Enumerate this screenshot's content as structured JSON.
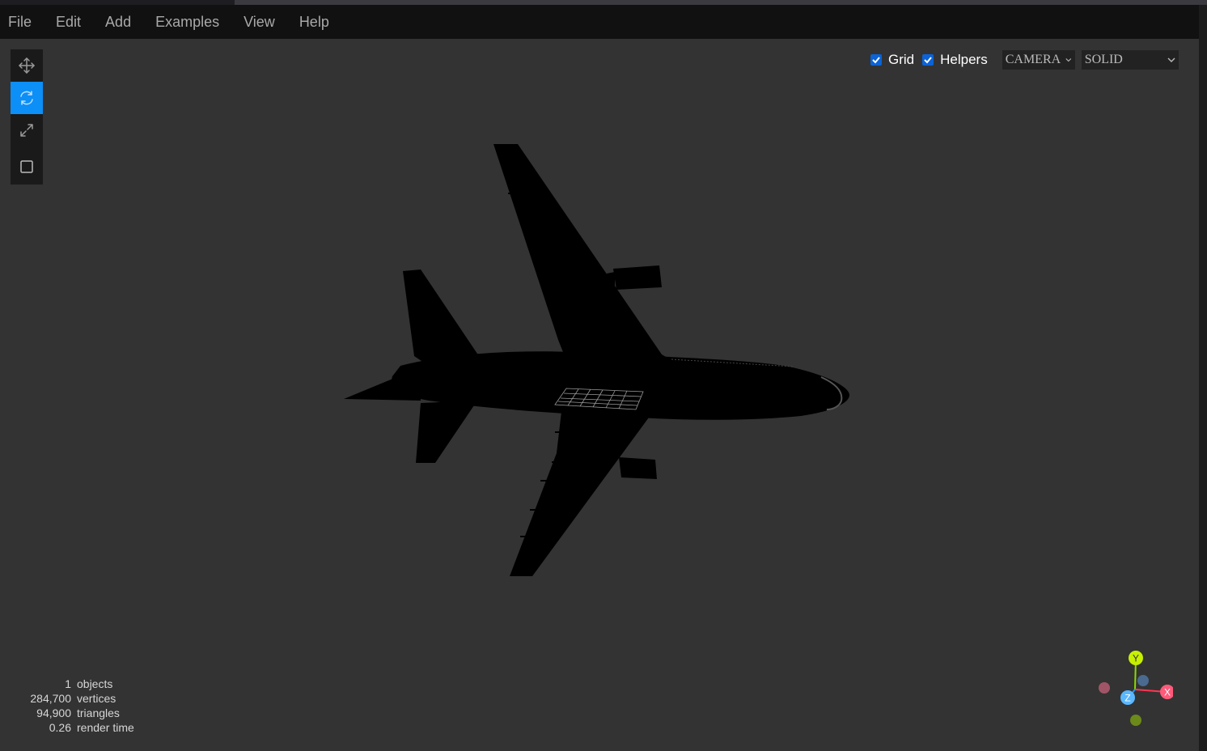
{
  "menubar": {
    "items": [
      {
        "label": "File"
      },
      {
        "label": "Edit"
      },
      {
        "label": "Add"
      },
      {
        "label": "Examples"
      },
      {
        "label": "View"
      },
      {
        "label": "Help"
      }
    ]
  },
  "toolbar": {
    "tools": [
      {
        "name": "translate",
        "icon": "move-icon",
        "active": false
      },
      {
        "name": "rotate",
        "icon": "rotate-icon",
        "active": true
      },
      {
        "name": "scale",
        "icon": "scale-icon",
        "active": false
      },
      {
        "name": "local",
        "icon": "square-icon",
        "active": false
      }
    ]
  },
  "viewport_controls": {
    "grid": {
      "label": "Grid",
      "checked": true
    },
    "helpers": {
      "label": "Helpers",
      "checked": true
    },
    "camera_select": {
      "value": "CAMERA"
    },
    "shading_select": {
      "value": "SOLID"
    }
  },
  "stats": [
    {
      "value": "1",
      "label": "objects"
    },
    {
      "value": "284,700",
      "label": "vertices"
    },
    {
      "value": "94,900",
      "label": "triangles"
    },
    {
      "value": "0.26",
      "label": "render time"
    }
  ],
  "axes_helper": {
    "x_label": "X",
    "y_label": "Y",
    "z_label": "Z",
    "colors": {
      "x": "#ff3653",
      "y": "#8adb00",
      "z": "#2c8fff"
    }
  },
  "colors": {
    "accent": "#0c8ff6",
    "menubar_bg": "#111111",
    "viewport_bg": "#333333",
    "model": "#000000"
  }
}
